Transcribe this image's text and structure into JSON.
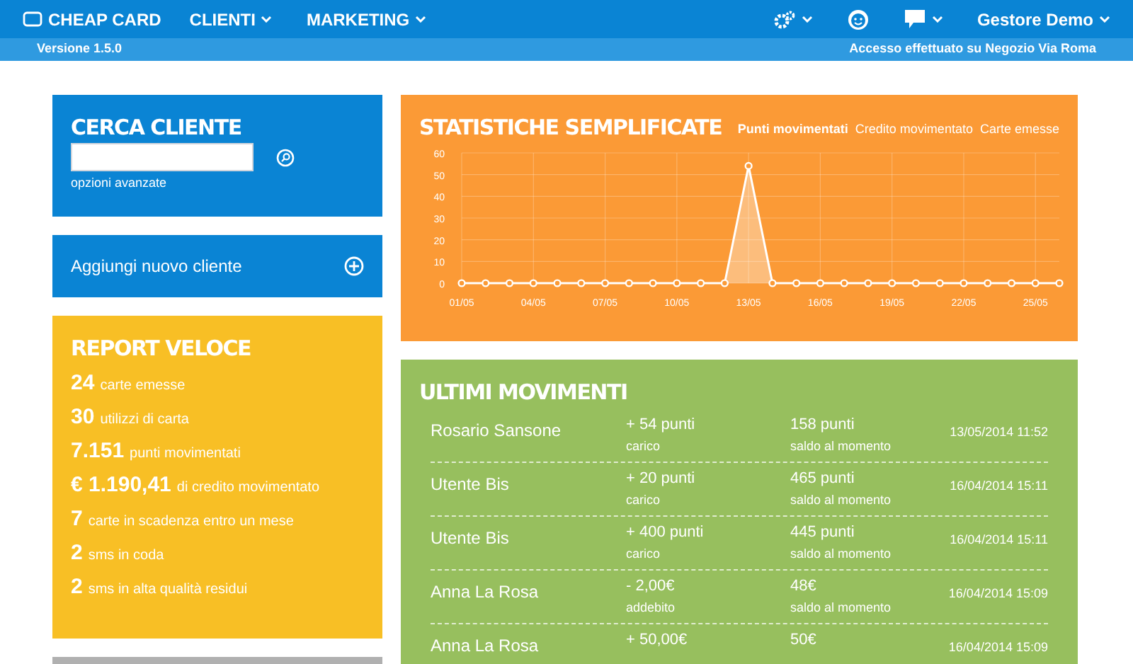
{
  "navbar": {
    "logo": "CHEAP CARD",
    "menus": [
      {
        "label": "CLIENTI"
      },
      {
        "label": "MARKETING"
      }
    ],
    "user": "Gestore Demo"
  },
  "subbar": {
    "version": "Versione 1.5.0",
    "access": "Accesso effettuato su Negozio Via Roma"
  },
  "search_card": {
    "title": "CERCA CLIENTE",
    "advanced_link": "opzioni avanzate"
  },
  "add_card": {
    "label": "Aggiungi nuovo cliente"
  },
  "report_card": {
    "title": "REPORT VELOCE",
    "items": [
      {
        "value": "24",
        "label": "carte emesse"
      },
      {
        "value": "30",
        "label": "utilizzi di carta"
      },
      {
        "value": "7.151",
        "label": "punti movimentati"
      },
      {
        "value": "€ 1.190,41",
        "label": "di credito movimentato"
      },
      {
        "value": "7",
        "label": "carte in scadenza entro un mese"
      },
      {
        "value": "2",
        "label": "sms in coda"
      },
      {
        "value": "2",
        "label": "sms in alta qualità residui"
      }
    ]
  },
  "stats_card": {
    "title": "STATISTICHE SEMPLIFICATE",
    "tabs": [
      {
        "label": "Punti movimentati",
        "selected": true
      },
      {
        "label": "Credito movimentato",
        "selected": false
      },
      {
        "label": "Carte emesse",
        "selected": false
      }
    ],
    "chart_data": {
      "type": "area",
      "categories": [
        "01/05",
        null,
        null,
        "04/05",
        null,
        null,
        "07/05",
        null,
        null,
        "10/05",
        null,
        null,
        "13/05",
        null,
        null,
        "16/05",
        null,
        null,
        "19/05",
        null,
        null,
        "22/05",
        null,
        null,
        "25/05",
        null
      ],
      "series": [
        {
          "color": "#ffffff",
          "values": [
            0,
            0,
            0,
            0,
            0,
            0,
            0,
            0,
            0,
            0,
            0,
            0,
            54,
            0,
            0,
            0,
            0,
            0,
            0,
            0,
            0,
            0,
            0,
            0,
            0,
            0
          ]
        }
      ],
      "grid": true,
      "ylim": [
        0,
        60
      ],
      "yticks": [
        0,
        10,
        20,
        30,
        40,
        50,
        60
      ]
    }
  },
  "movements_card": {
    "title": "ULTIMI MOVIMENTI",
    "rows": [
      {
        "name": "Rosario Sansone",
        "amount": "+ 54 punti",
        "type": "carico",
        "balance": "158 punti",
        "balance_label": "saldo al momento",
        "date": "13/05/2014 11:52"
      },
      {
        "name": "Utente Bis",
        "amount": "+ 20 punti",
        "type": "carico",
        "balance": "465 punti",
        "balance_label": "saldo al momento",
        "date": "16/04/2014 15:11"
      },
      {
        "name": "Utente Bis",
        "amount": "+ 400 punti",
        "type": "carico",
        "balance": "445 punti",
        "balance_label": "saldo al momento",
        "date": "16/04/2014 15:11"
      },
      {
        "name": "Anna La Rosa",
        "amount": "- 2,00€",
        "type": "addebito",
        "balance": "48€",
        "balance_label": "saldo al momento",
        "date": "16/04/2014 15:09"
      },
      {
        "name": "Anna La Rosa",
        "amount": "+ 50,00€",
        "balance": "50€",
        "date": "16/04/2014 15:09"
      }
    ]
  }
}
